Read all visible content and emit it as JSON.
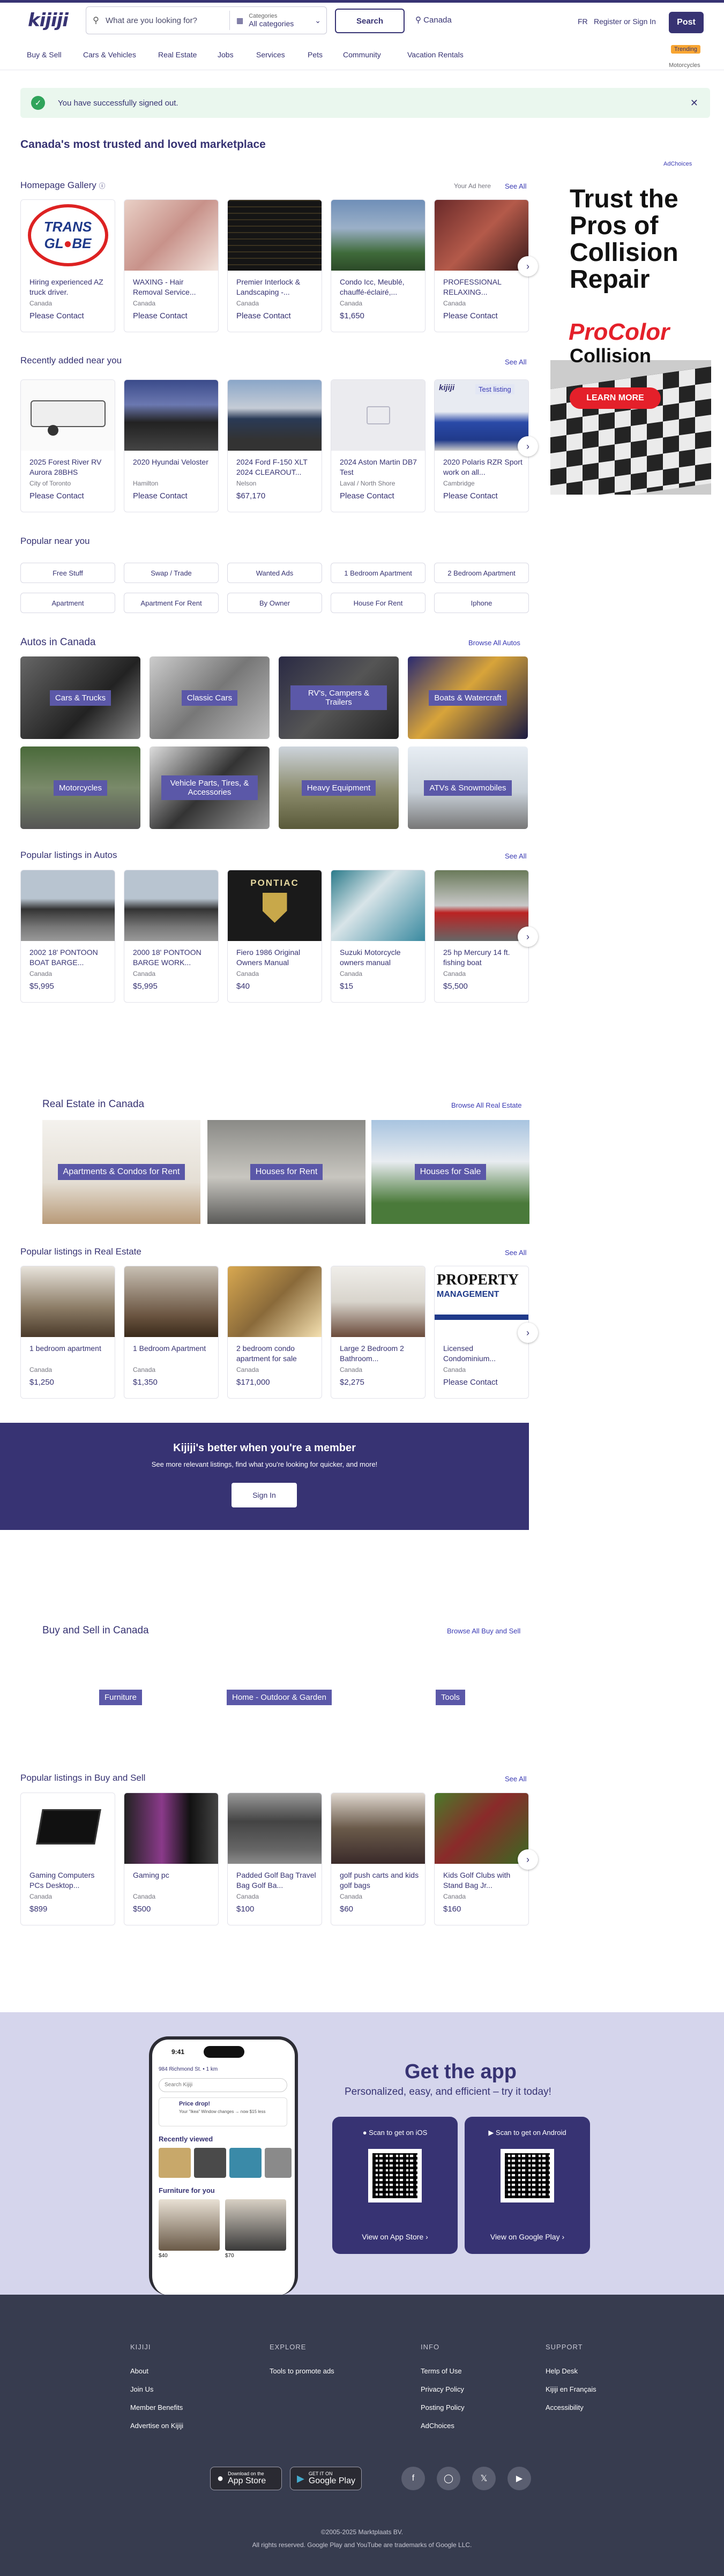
{
  "header": {
    "logo": "kijiji",
    "search_placeholder": "What are you looking for?",
    "category_label": "Categories",
    "category_value": "All categories",
    "search_button": "Search",
    "location": "Canada",
    "lang": "FR",
    "register_signin": "Register or Sign In",
    "post_button": "Post"
  },
  "nav": {
    "items": [
      "Buy & Sell",
      "Cars & Vehicles",
      "Real Estate",
      "Jobs",
      "Services",
      "Pets",
      "Community",
      "Vacation Rentals"
    ],
    "trending_badge": "Trending",
    "trending_sub": "Motorcycles"
  },
  "alert": {
    "text": "You have successfully signed out."
  },
  "page_title": "Canada's most trusted and loved marketplace",
  "gallery": {
    "title": "Homepage Gallery",
    "your_ad_here": "Your Ad here",
    "see_all": "See All",
    "items": [
      {
        "title": "Hiring experienced AZ truck driver.",
        "location": "Canada",
        "price": "Please Contact"
      },
      {
        "title": "WAXING - Hair Removal Service...",
        "location": "Canada",
        "price": "Please Contact"
      },
      {
        "title": "Premier Interlock & Landscaping -...",
        "location": "Canada",
        "price": "Please Contact"
      },
      {
        "title": "Condo Icc, Meublé, chauffé-éclairé,...",
        "location": "Canada",
        "price": "$1,650"
      },
      {
        "title": "PROFESSIONAL RELAXING...",
        "location": "Canada",
        "price": "Please Contact"
      }
    ]
  },
  "recent": {
    "title": "Recently added near you",
    "see_all": "See All",
    "items": [
      {
        "title": "2025 Forest River RV Aurora 28BHS",
        "location": "City of Toronto",
        "price": "Please Contact"
      },
      {
        "title": "2020 Hyundai Veloster",
        "location": "Hamilton",
        "price": "Please Contact"
      },
      {
        "title": "2024 Ford F-150 XLT 2024 CLEAROUT...",
        "location": "Nelson",
        "price": "$67,170"
      },
      {
        "title": "2024 Aston Martin DB7 Test",
        "location": "Laval / North Shore",
        "price": "Please Contact"
      },
      {
        "title": "2020 Polaris RZR Sport work on all...",
        "location": "Cambridge",
        "price": "Please Contact"
      }
    ],
    "test_listing_badge": "Test listing"
  },
  "ad": {
    "choices": "AdChoices",
    "headline": "Trust the Pros of Collision Repair",
    "brand1": "ProColor",
    "brand2": "Collision",
    "cta": "LEARN MORE"
  },
  "popular": {
    "title": "Popular near you",
    "pills": [
      "Free Stuff",
      "Swap / Trade",
      "Wanted Ads",
      "1 Bedroom Apartment",
      "2 Bedroom Apartment",
      "Apartment",
      "Apartment For Rent",
      "By Owner",
      "House For Rent",
      "Iphone"
    ]
  },
  "autos": {
    "title": "Autos in Canada",
    "browse": "Browse All Autos",
    "tiles": [
      "Cars & Trucks",
      "Classic Cars",
      "RV's, Campers & Trailers",
      "Boats & Watercraft",
      "Motorcycles",
      "Vehicle Parts, Tires, & Accessories",
      "Heavy Equipment",
      "ATVs & Snowmobiles"
    ]
  },
  "autos_listings": {
    "title": "Popular listings in Autos",
    "see_all": "See All",
    "items": [
      {
        "title": "2002 18' PONTOON BOAT BARGE...",
        "location": "Canada",
        "price": "$5,995"
      },
      {
        "title": "2000 18' PONTOON BARGE WORK...",
        "location": "Canada",
        "price": "$5,995"
      },
      {
        "title": "Fiero 1986 Original Owners Manual",
        "location": "Canada",
        "price": "$40"
      },
      {
        "title": "Suzuki Motorcycle owners manual",
        "location": "Canada",
        "price": "$15"
      },
      {
        "title": "25 hp Mercury 14 ft. fishing boat",
        "location": "Canada",
        "price": "$5,500"
      }
    ],
    "pontiac": "PONTIAC"
  },
  "realestate": {
    "title": "Real Estate in Canada",
    "browse": "Browse All Real Estate",
    "tiles": [
      "Apartments & Condos for Rent",
      "Houses for Rent",
      "Houses for Sale"
    ]
  },
  "re_listings": {
    "title": "Popular listings in Real Estate",
    "see_all": "See All",
    "items": [
      {
        "title": "1 bedroom apartment",
        "location": "Canada",
        "price": "$1,250"
      },
      {
        "title": "1 Bedroom Apartment",
        "location": "Canada",
        "price": "$1,350"
      },
      {
        "title": "2 bedroom condo apartment for sale",
        "location": "Canada",
        "price": "$171,000"
      },
      {
        "title": "Large 2 Bedroom 2 Bathroom...",
        "location": "Canada",
        "price": "$2,275"
      },
      {
        "title": "Licensed Condominium...",
        "location": "Canada",
        "price": "Please Contact"
      }
    ],
    "property_logo": "PROPERTY",
    "property_logo2": "MANAGEMENT"
  },
  "member": {
    "title": "Kijiji's better when you're a member",
    "sub": "See more relevant listings, find what you're looking for quicker, and more!",
    "button": "Sign In"
  },
  "buysell": {
    "title": "Buy and Sell in Canada",
    "browse": "Browse All Buy and Sell",
    "tiles": [
      "Furniture",
      "Home - Outdoor & Garden",
      "Tools"
    ]
  },
  "bs_listings": {
    "title": "Popular listings in Buy and Sell",
    "see_all": "See All",
    "items": [
      {
        "title": "Gaming Computers PCs Desktop...",
        "location": "Canada",
        "price": "$899"
      },
      {
        "title": "Gaming pc",
        "location": "Canada",
        "price": "$500"
      },
      {
        "title": "Padded Golf Bag Travel Bag Golf Ba...",
        "location": "Canada",
        "price": "$100"
      },
      {
        "title": "golf push carts and kids golf bags",
        "location": "Canada",
        "price": "$60"
      },
      {
        "title": "Kids Golf Clubs with Stand Bag Jr...",
        "location": "Canada",
        "price": "$160"
      }
    ]
  },
  "app": {
    "title": "Get the app",
    "sub": "Personalized, easy, and efficient – try it today!",
    "ios_caption": "Scan to get on iOS",
    "android_caption": "Scan to get on Android",
    "ios_link": "View on App Store",
    "android_link": "View on Google Play",
    "phone": {
      "time": "9:41",
      "address": "984 Richmond St. • 1 km",
      "search": "Search Kijiji",
      "price_drop": "Price drop!",
      "price_drop_sub": "Your \"Ikea\" Window changes → now $15 less",
      "recently_viewed": "Recently viewed",
      "furniture": "Furniture for you",
      "price1": "$40",
      "price2": "$70"
    }
  },
  "footer": {
    "cols": [
      {
        "head": "KIJIJI",
        "links": [
          "About",
          "Join Us",
          "Member Benefits",
          "Advertise on Kijiji"
        ]
      },
      {
        "head": "EXPLORE",
        "links": [
          "Tools to promote ads"
        ]
      },
      {
        "head": "INFO",
        "links": [
          "Terms of Use",
          "Privacy Policy",
          "Posting Policy",
          "AdChoices"
        ]
      },
      {
        "head": "SUPPORT",
        "links": [
          "Help Desk",
          "Kijiji en Français",
          "Accessibility"
        ]
      }
    ],
    "appstore_small": "Download on the",
    "appstore_big": "App Store",
    "gplay_small": "GET IT ON",
    "gplay_big": "Google Play",
    "copyright": "©2005-2025 Marktplaats BV.",
    "rights": "All rights reserved. Google Play and YouTube are trademarks of Google LLC."
  },
  "colors": {
    "brand": "#373373",
    "accent": "#f8a532",
    "success": "#30a45b",
    "tile_label": "#5b58a8",
    "footer": "#373c4f",
    "app_bg": "#d5d5ec"
  }
}
